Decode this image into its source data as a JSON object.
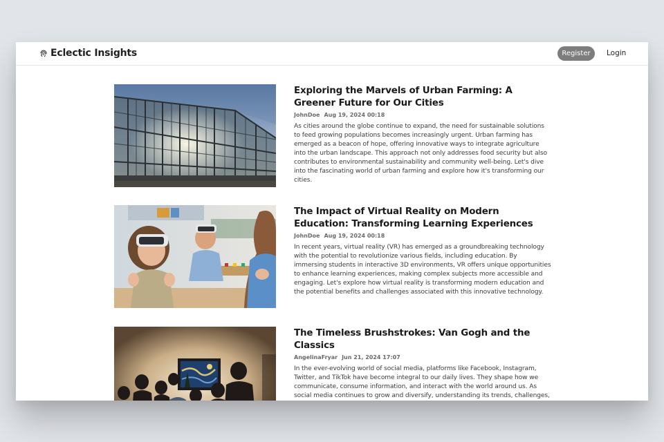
{
  "site": {
    "brand_name": "Eclectic Insights",
    "brand_icon": "fingerprint-icon",
    "register_label": "Register",
    "login_label": "Login"
  },
  "articles": [
    {
      "title": "Exploring the Marvels of Urban Farming: A Greener Future for Our Cities",
      "author": "JohnDoe",
      "date": "Aug 19, 2024 00:18",
      "excerpt": "As cities around the globe continue to expand, the need for sustainable solutions to feed growing populations becomes increasingly urgent. Urban farming has emerged as a beacon of hope, offering innovative ways to integrate agriculture into the urban landscape. This approach not only addresses food security but also contributes to environmental sustainability and community well-being. Let's dive into the fascinating world of urban farming and explore how it's transforming our cities."
    },
    {
      "title": "The Impact of Virtual Reality on Modern Education: Transforming Learning Experiences",
      "author": "JohnDoe",
      "date": "Aug 19, 2024 00:18",
      "excerpt": "In recent years, virtual reality (VR) has emerged as a groundbreaking technology with the potential to revolutionize various fields, including education. By immersing students in interactive 3D environments, VR offers unique opportunities to enhance learning experiences, making complex subjects more accessible and engaging. Let's explore how virtual reality is transforming modern education and the potential benefits and challenges associated with this innovative technology."
    },
    {
      "title": "The Timeless Brushstrokes: Van Gogh and the Classics",
      "author": "AngelinaFryar",
      "date": "Jun 21, 2024 17:07",
      "excerpt": "In the ever-evolving world of social media, platforms like Facebook, Instagram, Twitter, and TikTok have become integral to our daily lives. They shape how we communicate, consume information, and interact with the world around us. As social media continues to grow and diversify, understanding its trends, challenges, and future directions becomes crucial for users, businesses, and creators alike. This article"
    }
  ],
  "colors": {
    "page_background": "#e1e4e9",
    "register_button": "#7d7d7d",
    "title_text": "#1a1a1a",
    "meta_text": "#6a6a6a"
  }
}
